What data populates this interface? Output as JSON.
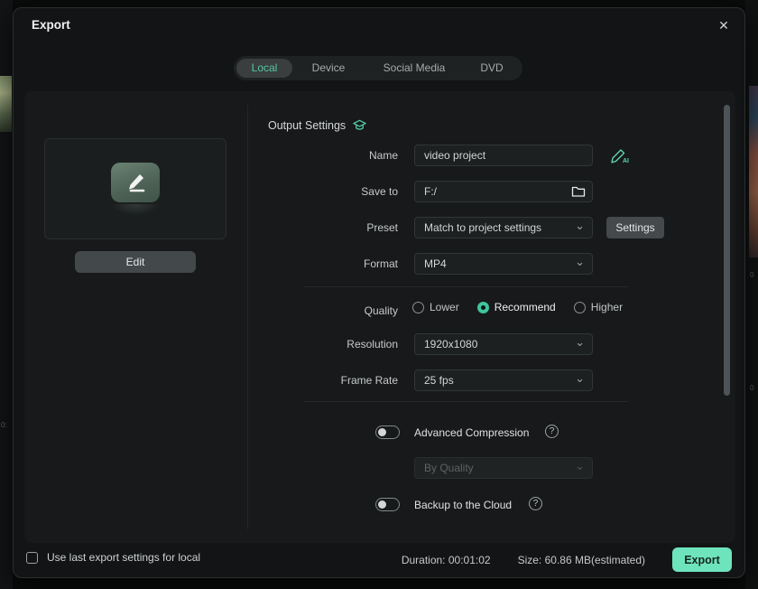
{
  "window": {
    "title": "Export"
  },
  "icons": {
    "close": "✕",
    "chevron": "⌄",
    "help": "?",
    "ai_suffix": "AI",
    "left_edge_mark": "0:",
    "right_edge_mark_1": "0",
    "right_edge_mark_2": "0"
  },
  "tabs": {
    "active": "Local",
    "items": [
      {
        "label": "Local"
      },
      {
        "label": "Device"
      },
      {
        "label": "Social Media"
      },
      {
        "label": "DVD"
      }
    ]
  },
  "preview": {
    "edit_button": "Edit"
  },
  "form": {
    "section_title": "Output Settings",
    "name": {
      "label": "Name",
      "value": "video project"
    },
    "save_to": {
      "label": "Save to",
      "value": "F:/"
    },
    "preset": {
      "label": "Preset",
      "value": "Match to project settings"
    },
    "settings_button": "Settings",
    "format": {
      "label": "Format",
      "value": "MP4"
    },
    "quality": {
      "label": "Quality",
      "options": [
        {
          "label": "Lower",
          "selected": false
        },
        {
          "label": "Recommend",
          "selected": true
        },
        {
          "label": "Higher",
          "selected": false
        }
      ]
    },
    "resolution": {
      "label": "Resolution",
      "value": "1920x1080"
    },
    "frame_rate": {
      "label": "Frame Rate",
      "value": "25 fps"
    },
    "advanced_compression": {
      "label": "Advanced Compression",
      "enabled": false
    },
    "compression_mode": {
      "value": "By Quality",
      "disabled": true
    },
    "backup": {
      "label": "Backup to the Cloud",
      "enabled": false
    }
  },
  "footer": {
    "use_last_label": "Use last export settings for local",
    "checked": false,
    "duration_label": "Duration:",
    "duration_value": "00:01:02",
    "size_label": "Size:",
    "size_value": "60.86 MB(estimated)",
    "export_button": "Export"
  },
  "colors": {
    "accent": "#53c8a3",
    "export_button": "#6ee4bd",
    "radio_selected": "#3fc49c"
  }
}
